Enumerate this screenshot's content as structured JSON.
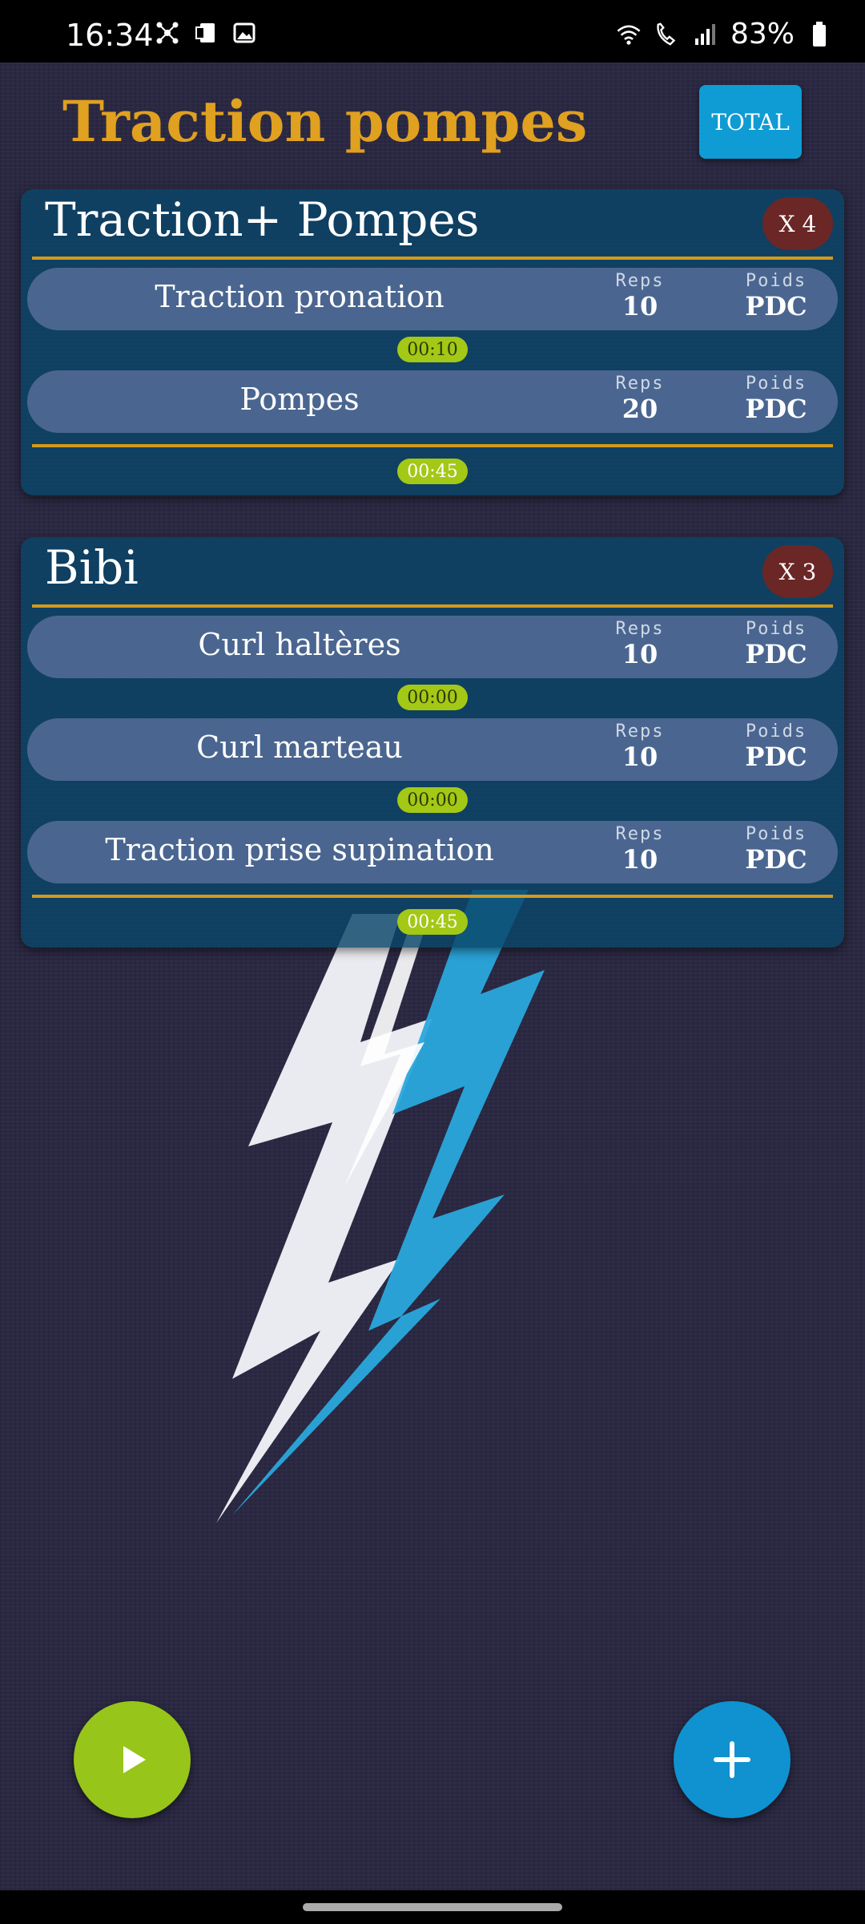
{
  "status_bar": {
    "time": "16:34",
    "battery": "83%",
    "left_icons": [
      "network-sharing-icon",
      "sim-icon",
      "gallery-icon"
    ],
    "right_icons": [
      "wifi-icon",
      "wifi-call-icon",
      "signal-icon",
      "battery-icon"
    ]
  },
  "header": {
    "title": "Traction pompes",
    "total_label": "TOTAL"
  },
  "colors": {
    "title": "#e0a020",
    "accent_blue": "#0f9bd4",
    "play_green": "#97c51a",
    "rest_pill": "#a3c816",
    "badge": "#6b2626"
  },
  "labels": {
    "reps": "Reps",
    "weight": "Poids"
  },
  "circuits": [
    {
      "title": "Traction+ Pompes",
      "rounds": "X 4",
      "exercises": [
        {
          "name": "Traction pronation",
          "reps": "10",
          "weight": "PDC",
          "rest": "00:10"
        },
        {
          "name": "Pompes",
          "reps": "20",
          "weight": "PDC"
        }
      ],
      "round_rest": "00:45"
    },
    {
      "title": "Bibi",
      "rounds": "X 3",
      "exercises": [
        {
          "name": "Curl haltères",
          "reps": "10",
          "weight": "PDC",
          "rest": "00:00"
        },
        {
          "name": "Curl marteau",
          "reps": "10",
          "weight": "PDC",
          "rest": "00:00"
        },
        {
          "name": "Traction prise supination",
          "reps": "10",
          "weight": "PDC"
        }
      ],
      "round_rest": "00:45"
    }
  ],
  "fabs": {
    "play_icon": "play-icon",
    "add_icon": "plus-icon"
  }
}
